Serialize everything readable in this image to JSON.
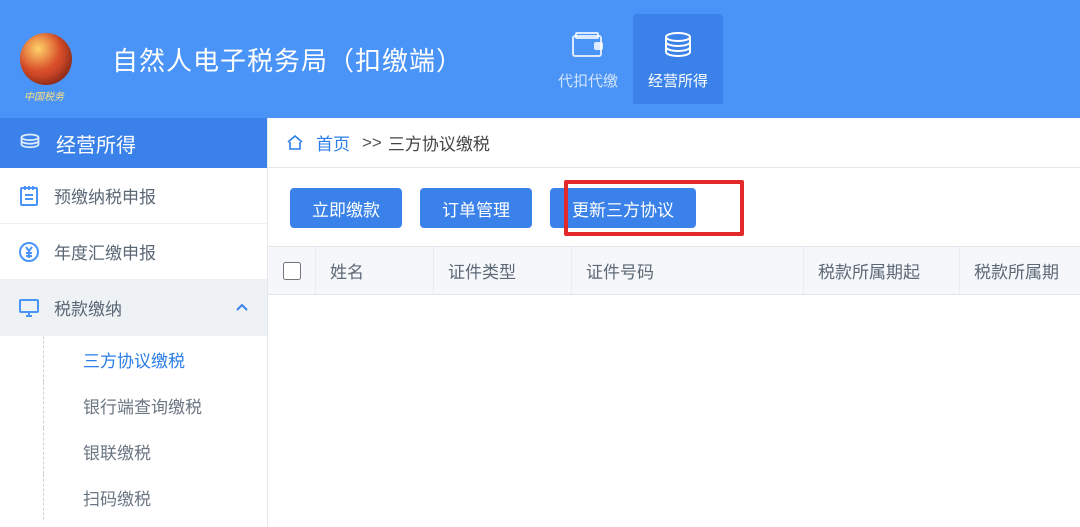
{
  "colors": {
    "primary": "#4a94f8",
    "primaryDark": "#3a82ea",
    "highlight": "#e22a2a"
  },
  "header": {
    "appTitle": "自然人电子税务局（扣缴端）",
    "logoCaption": "中国税务",
    "tabs": [
      {
        "id": "withholding",
        "label": "代扣代缴",
        "icon": "wallet-icon"
      },
      {
        "id": "business-income",
        "label": "经营所得",
        "icon": "coins-icon"
      }
    ],
    "activeTab": "business-income"
  },
  "sidebar": {
    "title": "经营所得",
    "items": [
      {
        "id": "prepay",
        "label": "预缴纳税申报",
        "icon": "notepad-icon"
      },
      {
        "id": "annual",
        "label": "年度汇缴申报",
        "icon": "yen-circle-icon"
      },
      {
        "id": "payment",
        "label": "税款缴纳",
        "icon": "monitor-icon",
        "expanded": true,
        "children": [
          {
            "id": "tripartite",
            "label": "三方协议缴税",
            "active": true
          },
          {
            "id": "bank-query",
            "label": "银行端查询缴税"
          },
          {
            "id": "unionpay",
            "label": "银联缴税"
          },
          {
            "id": "scan-pay",
            "label": "扫码缴税"
          }
        ]
      }
    ]
  },
  "breadcrumb": {
    "homeLabel": "首页",
    "separator": ">>",
    "current": "三方协议缴税"
  },
  "toolbar": {
    "btnPayNow": "立即缴款",
    "btnOrders": "订单管理",
    "btnRefresh": "更新三方协议",
    "highlighted": "btnRefresh"
  },
  "table": {
    "columns": [
      {
        "id": "select",
        "label": ""
      },
      {
        "id": "name",
        "label": "姓名"
      },
      {
        "id": "docType",
        "label": "证件类型"
      },
      {
        "id": "docNo",
        "label": "证件号码"
      },
      {
        "id": "periodStart",
        "label": "税款所属期起"
      },
      {
        "id": "periodEnd",
        "label": "税款所属期"
      }
    ],
    "rows": []
  }
}
